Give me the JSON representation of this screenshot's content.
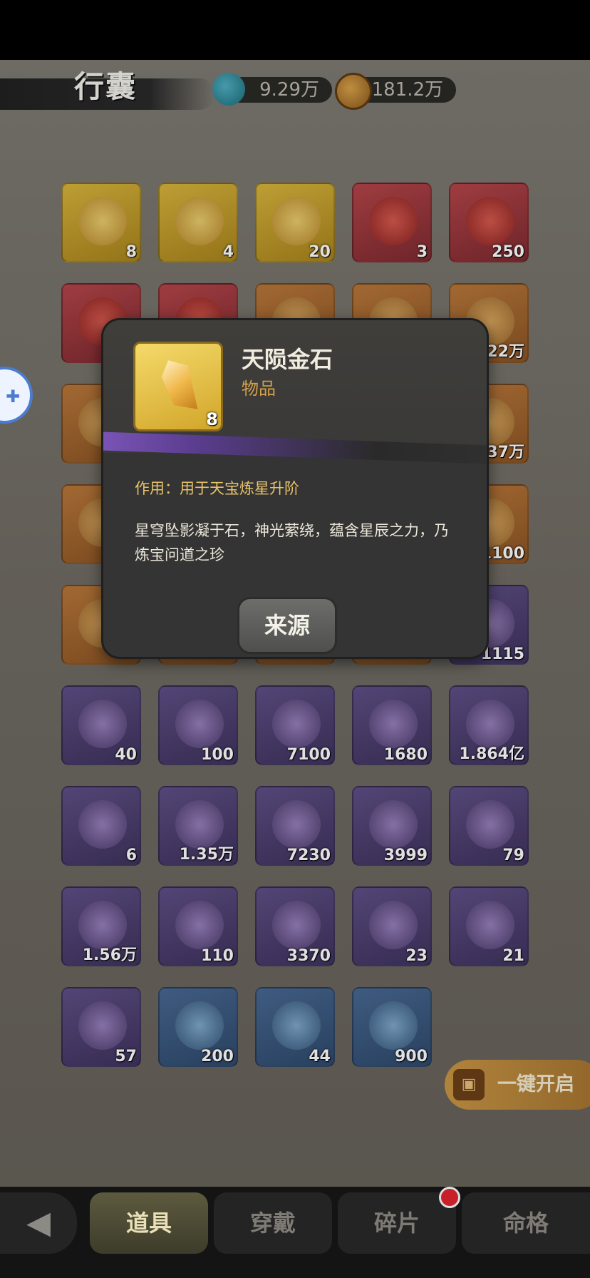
{
  "header": {
    "title": "行囊",
    "currencies": [
      {
        "icon": "jade-icon",
        "value": "9.29万"
      },
      {
        "icon": "coin-icon",
        "value": "181.2万"
      }
    ]
  },
  "grid": {
    "items": [
      {
        "quality": "gold",
        "count": "8"
      },
      {
        "quality": "gold",
        "count": "4"
      },
      {
        "quality": "gold",
        "count": "20"
      },
      {
        "quality": "red",
        "count": "3"
      },
      {
        "quality": "red",
        "count": "250"
      },
      {
        "quality": "red",
        "count": ""
      },
      {
        "quality": "red",
        "count": ""
      },
      {
        "quality": "orange",
        "count": ""
      },
      {
        "quality": "orange",
        "count": ""
      },
      {
        "quality": "orange",
        "count": "22万"
      },
      {
        "quality": "orange",
        "count": ""
      },
      {
        "quality": "orange",
        "count": ""
      },
      {
        "quality": "orange",
        "count": ""
      },
      {
        "quality": "orange",
        "count": ""
      },
      {
        "quality": "orange",
        "count": "37万"
      },
      {
        "quality": "orange",
        "count": ""
      },
      {
        "quality": "orange",
        "count": ""
      },
      {
        "quality": "orange",
        "count": ""
      },
      {
        "quality": "orange",
        "count": ""
      },
      {
        "quality": "orange",
        "count": "1100"
      },
      {
        "quality": "orange",
        "count": ""
      },
      {
        "quality": "orange",
        "count": ""
      },
      {
        "quality": "orange",
        "count": ""
      },
      {
        "quality": "orange",
        "count": ""
      },
      {
        "quality": "purple",
        "count": "1115"
      },
      {
        "quality": "purple",
        "count": "40"
      },
      {
        "quality": "purple",
        "count": "100"
      },
      {
        "quality": "purple",
        "count": "7100"
      },
      {
        "quality": "purple",
        "count": "1680"
      },
      {
        "quality": "purple",
        "count": "1.864亿"
      },
      {
        "quality": "purple",
        "count": "6"
      },
      {
        "quality": "purple",
        "count": "1.35万"
      },
      {
        "quality": "purple",
        "count": "7230"
      },
      {
        "quality": "purple",
        "count": "3999"
      },
      {
        "quality": "purple",
        "count": "79"
      },
      {
        "quality": "purple",
        "count": "1.56万"
      },
      {
        "quality": "purple",
        "count": "110"
      },
      {
        "quality": "purple",
        "count": "3370"
      },
      {
        "quality": "purple",
        "count": "23"
      },
      {
        "quality": "purple",
        "count": "21"
      },
      {
        "quality": "purple",
        "count": "57"
      },
      {
        "quality": "blue",
        "count": "200"
      },
      {
        "quality": "blue",
        "count": "44"
      },
      {
        "quality": "blue",
        "count": "900"
      }
    ]
  },
  "open_all_label": "一键开启",
  "tabs": [
    {
      "label": "道具",
      "active": true
    },
    {
      "label": "穿戴",
      "active": false
    },
    {
      "label": "碎片",
      "active": false,
      "badge": true
    },
    {
      "label": "命格",
      "active": false
    }
  ],
  "dialog": {
    "name": "天陨金石",
    "type": "物品",
    "count": "8",
    "usage": "作用：用于天宝炼星升阶",
    "description": "星穹坠影凝于石，神光萦绕，蕴含星辰之力，乃炼宝问道之珍",
    "source_button": "来源"
  },
  "colors": {
    "accent_gold": "#d3a04a",
    "usage_text": "#e8c36b",
    "badge_red": "#c8202a"
  }
}
